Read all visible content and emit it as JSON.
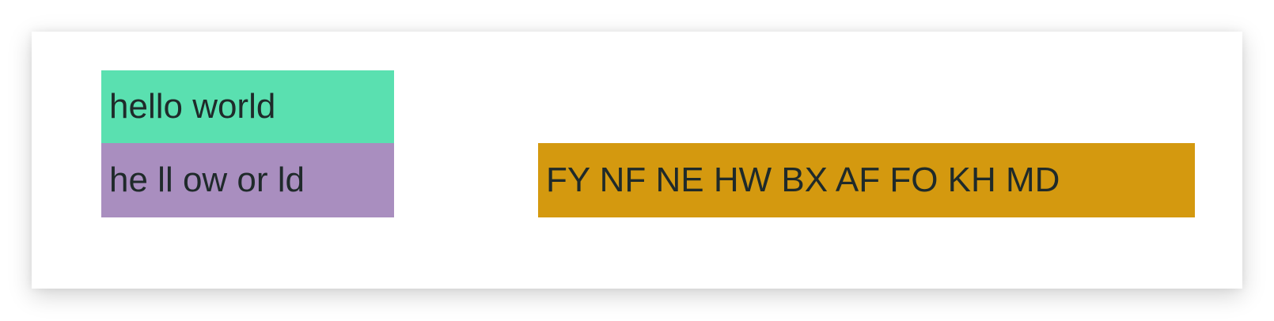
{
  "boxes": [
    {
      "text": "hello world",
      "color": "#5ae0b0"
    },
    {
      "text": "he ll ow or ld",
      "color": "#a98ebf"
    },
    {
      "text": "FY NF NE HW BX AF FO KH MD",
      "color": "#d4990f"
    }
  ]
}
